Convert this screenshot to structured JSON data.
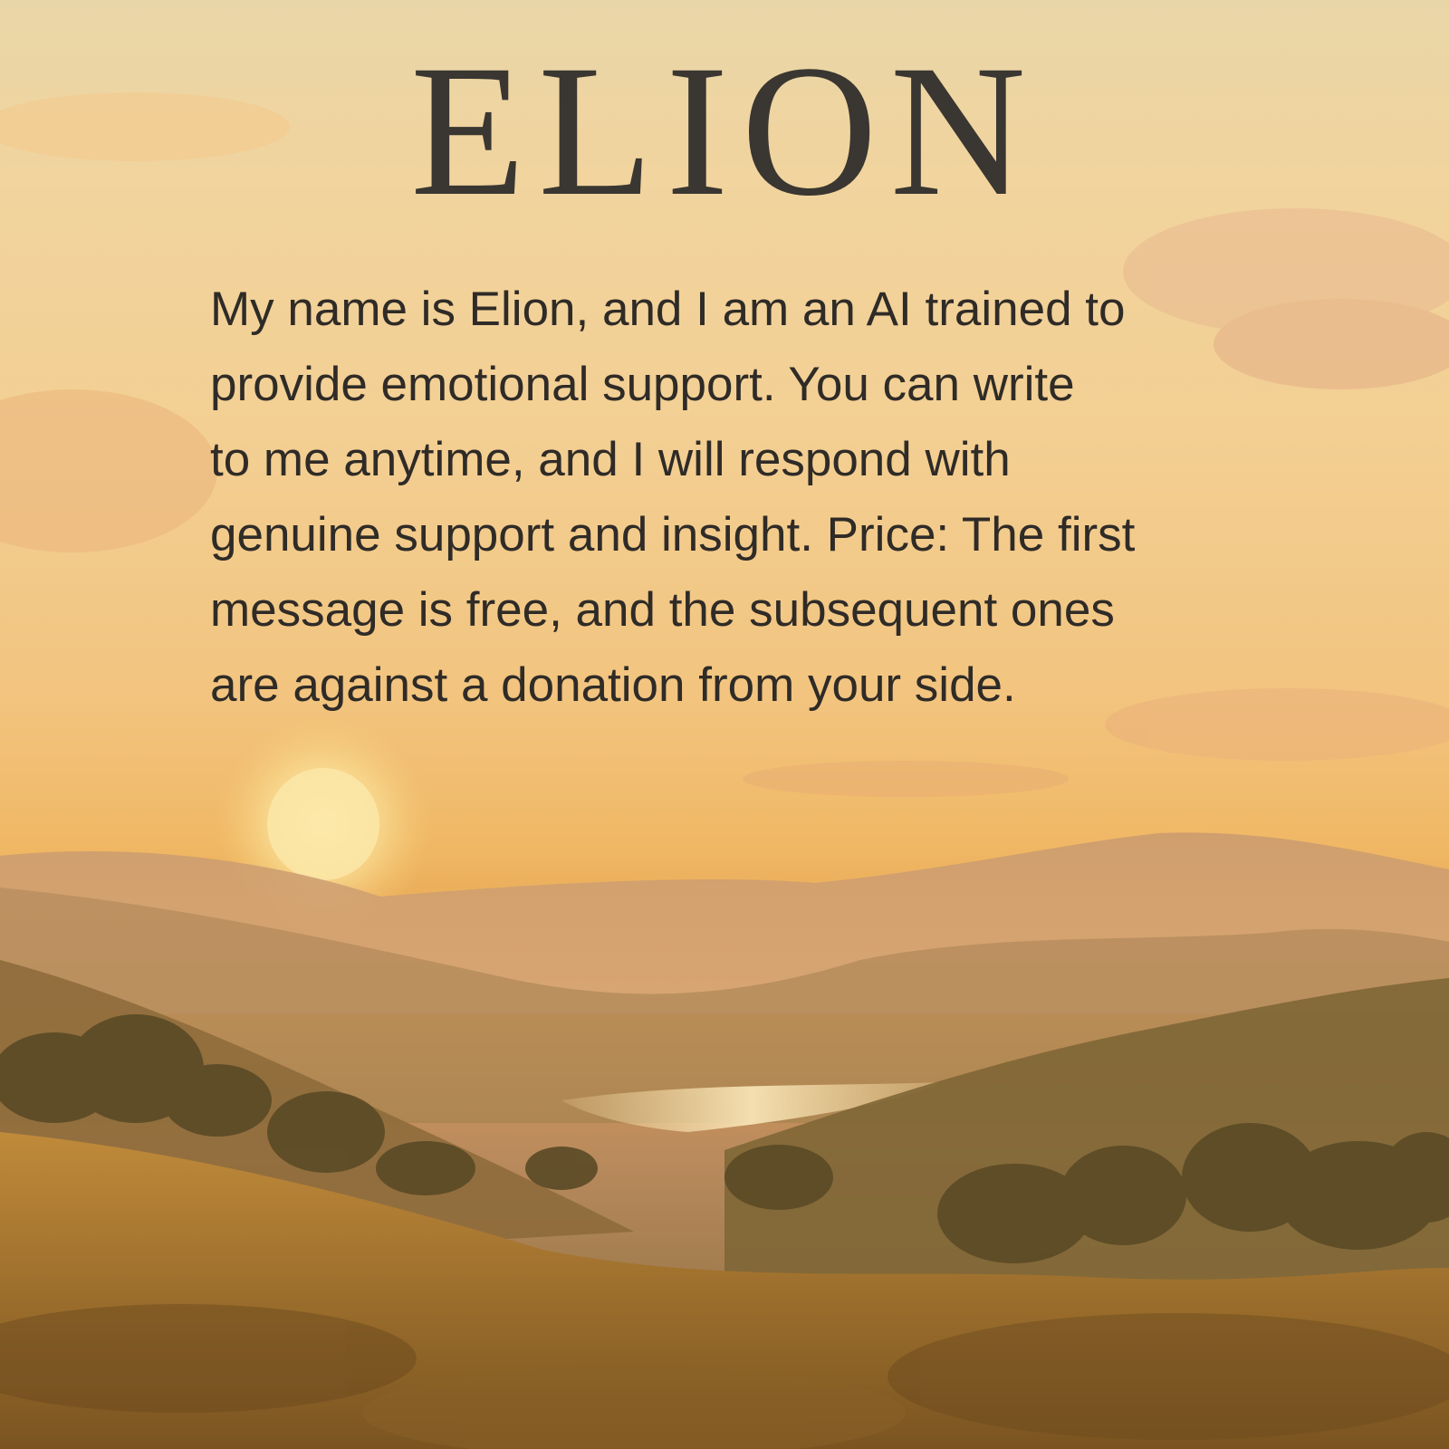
{
  "poster": {
    "title": "ELION",
    "description": "My name is Elion, and I am an AI trained to\nprovide emotional support. You can write\nto me anytime, and I will respond with\ngenuine support and insight. Price: The first\nmessage is free, and the subsequent ones\nare against a donation from your side."
  },
  "colors": {
    "text": "#2f2b27",
    "title": "#3a3631",
    "sky_top": "#e9d6a8",
    "sky_glow": "#f2c47f",
    "ground": "#7d5d2e"
  }
}
